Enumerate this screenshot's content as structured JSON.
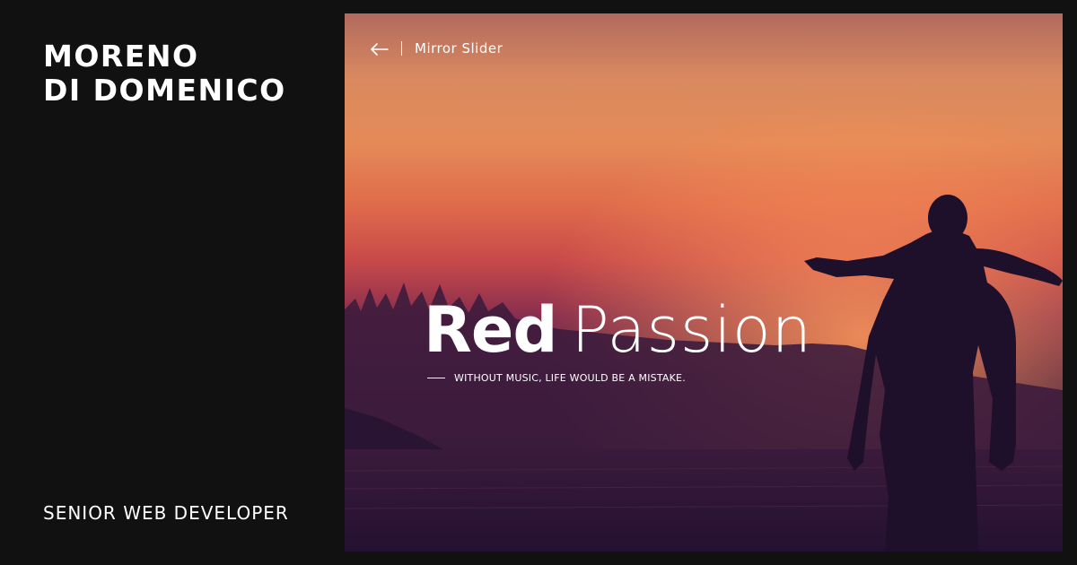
{
  "author": {
    "name_line1": "MORENO",
    "name_line2": "DI DOMENICO",
    "role": "SENIOR WEB DEVELOPER"
  },
  "preview": {
    "back_icon": "arrow-left-icon",
    "nav_title": "Mirror Slider",
    "title_bold": "Red",
    "title_light": "Passion",
    "subtitle": "WITHOUT MUSIC, LIFE WOULD BE A MISTAKE."
  },
  "colors": {
    "background": "#111111",
    "text": "#ffffff",
    "sky_top": "#b16a5e",
    "sky_glow": "#e58a57",
    "sky_red": "#c8494a",
    "ground": "#2a1433",
    "silhouette": "#1e0f2a"
  }
}
